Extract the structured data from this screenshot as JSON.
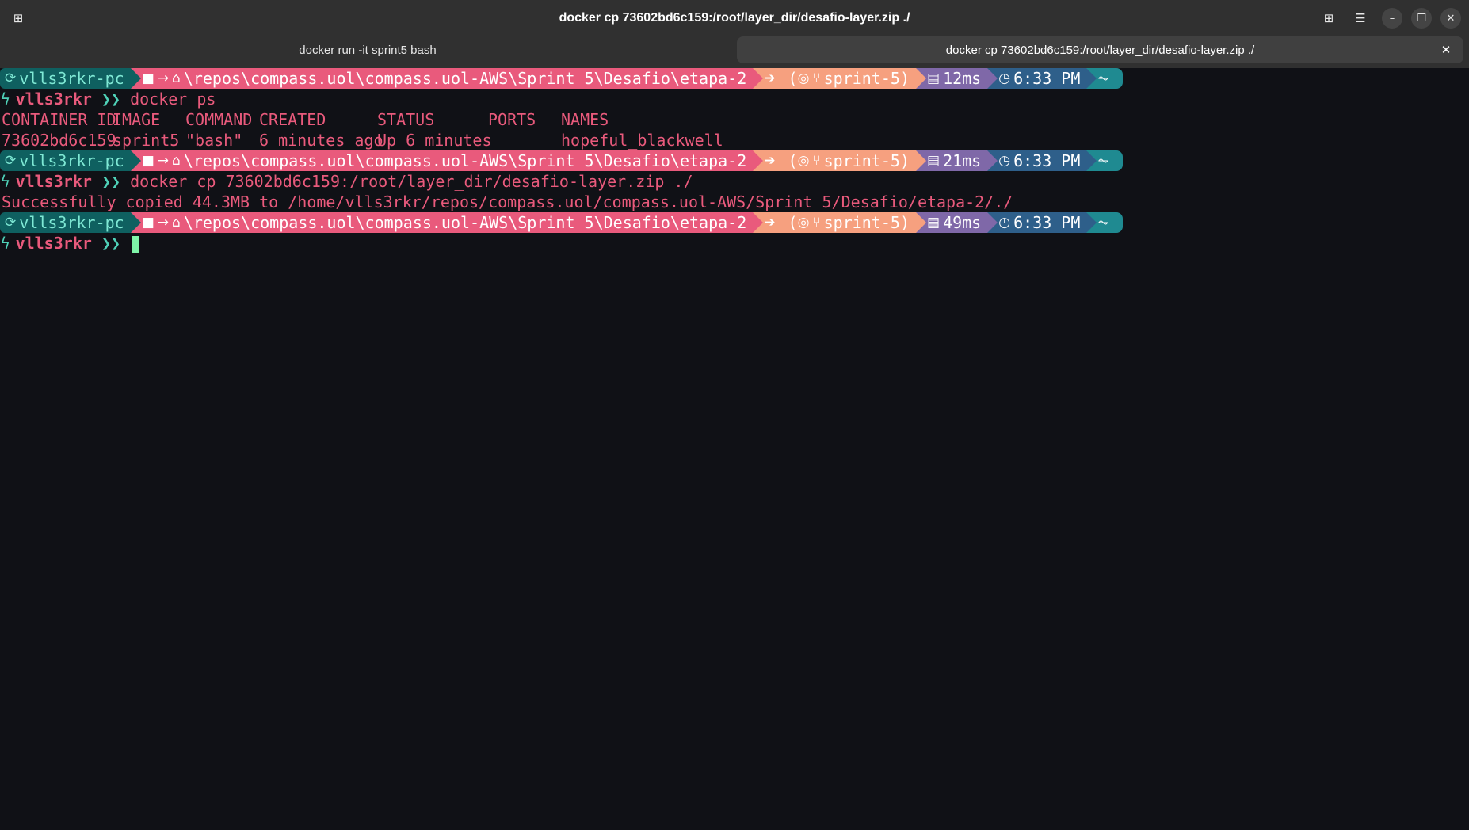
{
  "window": {
    "title": "docker cp 73602bd6c159:/root/layer_dir/desafio-layer.zip ./"
  },
  "tabs": [
    {
      "label": "docker run -it sprint5 bash",
      "active": false
    },
    {
      "label": "docker cp 73602bd6c159:/root/layer_dir/desafio-layer.zip ./",
      "active": true
    }
  ],
  "icons": {
    "new_tab": "⊞",
    "grid": "⊞",
    "menu": "☰",
    "minimize": "–",
    "maximize": "❐",
    "close": "✕",
    "tab_close": "✕"
  },
  "prompt": {
    "host": "vlls3rkr-pc",
    "path": "\\repos\\compass.uol\\compass.uol-AWS\\Sprint 5\\Desafio\\etapa-2",
    "git": "sprint-5)",
    "time": "6:33 PM",
    "user": "vlls3rkr",
    "arrow": "❯❯"
  },
  "blocks": [
    {
      "exec_time": "12ms",
      "command": "docker ps"
    },
    {
      "exec_time": "21ms",
      "command": "docker cp 73602bd6c159:/root/layer_dir/desafio-layer.zip ./"
    },
    {
      "exec_time": "49ms",
      "command": ""
    }
  ],
  "docker_ps": {
    "headers": [
      "CONTAINER ID",
      "IMAGE",
      "COMMAND",
      "CREATED",
      "STATUS",
      "PORTS",
      "NAMES"
    ],
    "rows": [
      [
        "73602bd6c159",
        "sprint5",
        "\"bash\"",
        "6 minutes ago",
        "Up 6 minutes",
        "",
        "hopeful_blackwell"
      ]
    ]
  },
  "cp_output": "Successfully copied 44.3MB to /home/vlls3rkr/repos/compass.uol/compass.uol-AWS/Sprint 5/Desafio/etapa-2/./",
  "colors": {
    "terminal_bg": "#101116",
    "pink": "#e95a7c",
    "teal": "#4fd1b8"
  }
}
